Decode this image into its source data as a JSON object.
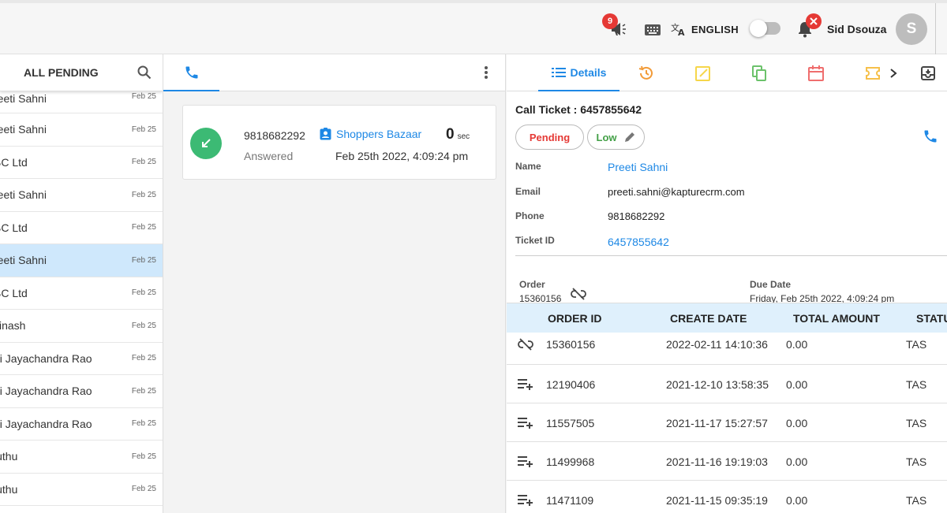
{
  "topbar": {
    "announcement_badge": "9",
    "language": "ENGLISH",
    "user_name": "Sid Dsouza",
    "avatar_initial": "S"
  },
  "left_panel": {
    "title": "ALL PENDING",
    "items": [
      {
        "name": "reeti Sahni",
        "date": "Feb 25"
      },
      {
        "name": "reeti Sahni",
        "date": "Feb 25"
      },
      {
        "name": "BC Ltd",
        "date": "Feb 25"
      },
      {
        "name": "reeti Sahni",
        "date": "Feb 25"
      },
      {
        "name": "BC Ltd",
        "date": "Feb 25"
      },
      {
        "name": "reeti Sahni",
        "date": "Feb 25"
      },
      {
        "name": "BC Ltd",
        "date": "Feb 25"
      },
      {
        "name": "vinash",
        "date": "Feb 25"
      },
      {
        "name": "ai Jayachandra Rao",
        "date": "Feb 25"
      },
      {
        "name": "ai Jayachandra Rao",
        "date": "Feb 25"
      },
      {
        "name": "ai Jayachandra Rao",
        "date": "Feb 25"
      },
      {
        "name": "luthu",
        "date": "Feb 25"
      },
      {
        "name": "luthu",
        "date": "Feb 25"
      }
    ]
  },
  "call_card": {
    "phone": "9818682292",
    "status": "Answered",
    "contact": "Shoppers Bazaar",
    "duration": "0",
    "duration_unit": "sec",
    "datetime": "Feb 25th 2022, 4:09:24 pm"
  },
  "right_panel": {
    "details_tab": "Details",
    "ticket_title": "Call Ticket : 6457855642",
    "status_pill": "Pending",
    "priority_pill": "Low",
    "fields": {
      "name_label": "Name",
      "name_value": "Preeti Sahni",
      "email_label": "Email",
      "email_value": "preeti.sahni@kapturecrm.com",
      "phone_label": "Phone",
      "phone_value": "9818682292",
      "ticket_label": "Ticket ID",
      "ticket_value": "6457855642"
    },
    "order_label": "Order",
    "order_value": "15360156",
    "due_label": "Due Date",
    "due_value": "Friday, Feb 25th 2022, 4:09:24 pm",
    "table": {
      "headers": [
        "ORDER ID",
        "CREATE DATE",
        "TOTAL AMOUNT",
        "STATU"
      ],
      "rows": [
        {
          "id": "15360156",
          "date": "2022-02-11 14:10:36",
          "amount": "0.00",
          "status": "TAS"
        },
        {
          "id": "12190406",
          "date": "2021-12-10 13:58:35",
          "amount": "0.00",
          "status": "TAS"
        },
        {
          "id": "11557505",
          "date": "2021-11-17 15:27:57",
          "amount": "0.00",
          "status": "TAS"
        },
        {
          "id": "11499968",
          "date": "2021-11-16 19:19:03",
          "amount": "0.00",
          "status": "TAS"
        },
        {
          "id": "11471109",
          "date": "2021-11-15 09:35:19",
          "amount": "0.00",
          "status": "TAS"
        }
      ]
    }
  },
  "colors": {
    "accent": "#1e88e5",
    "badge_red": "#e53935",
    "answered_green": "#3cba74",
    "selected_row": "#cfe8fc",
    "table_header": "#dff0fc"
  }
}
